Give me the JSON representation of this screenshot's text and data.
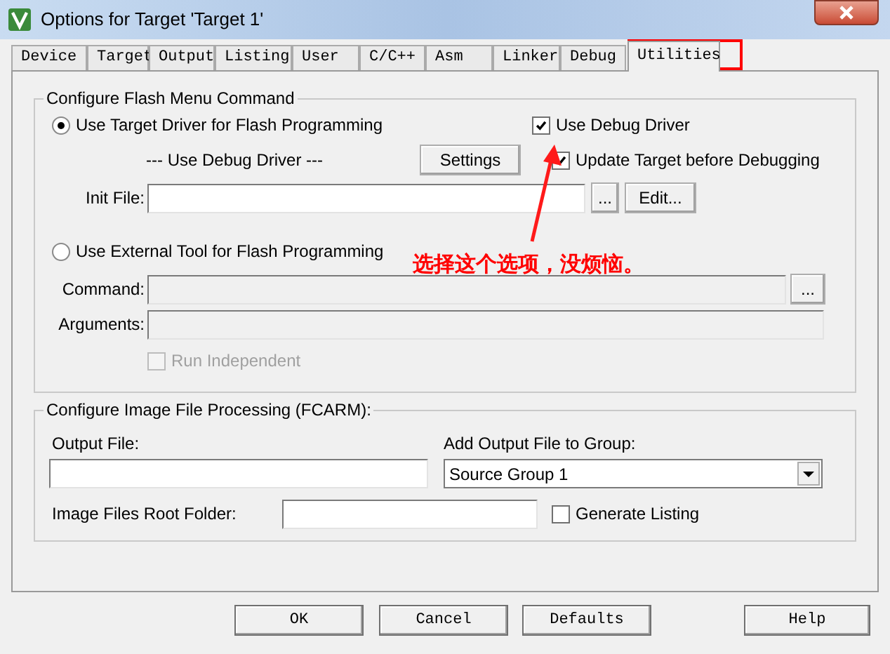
{
  "window": {
    "title": "Options for Target 'Target 1'"
  },
  "tabs": [
    {
      "label": "Device",
      "selected": false
    },
    {
      "label": "Target",
      "selected": false
    },
    {
      "label": "Output",
      "selected": false
    },
    {
      "label": "Listing",
      "selected": false
    },
    {
      "label": "User",
      "selected": false
    },
    {
      "label": "C/C++",
      "selected": false
    },
    {
      "label": "Asm",
      "selected": false
    },
    {
      "label": "Linker",
      "selected": false
    },
    {
      "label": "Debug",
      "selected": false
    },
    {
      "label": "Utilities",
      "selected": true
    }
  ],
  "flash_group": {
    "title": "Configure Flash Menu Command",
    "options": [
      {
        "label": "Use Target Driver for Flash Programming",
        "selected": true
      },
      {
        "label": "Use External Tool for Flash Programming",
        "selected": false
      }
    ],
    "driver_label": "--- Use Debug Driver ---",
    "settings_button": "Settings",
    "use_debug_driver": {
      "label": "Use Debug Driver",
      "checked": true
    },
    "update_target": {
      "label": "Update Target before Debugging",
      "checked": true
    },
    "init_file": {
      "label": "Init File:",
      "browse": "...",
      "edit": "Edit..."
    },
    "command": {
      "label": "Command:",
      "browse": "...",
      "disabled": true
    },
    "arguments": {
      "label": "Arguments:",
      "disabled": true
    },
    "run_independent": {
      "label": "Run Independent",
      "checked": false,
      "disabled": true
    }
  },
  "image_group": {
    "title": "Configure Image File Processing (FCARM):",
    "output_file": {
      "label": "Output File:"
    },
    "group": {
      "label": "Add Output File  to Group:",
      "value": "Source Group 1"
    },
    "root_folder": {
      "label": "Image Files Root Folder:"
    },
    "generate_listing": {
      "label": "Generate Listing",
      "checked": false
    }
  },
  "annotation": {
    "text": "选择这个选项，没烦恼。"
  },
  "buttons": [
    "OK",
    "Cancel",
    "Defaults",
    "Help"
  ]
}
